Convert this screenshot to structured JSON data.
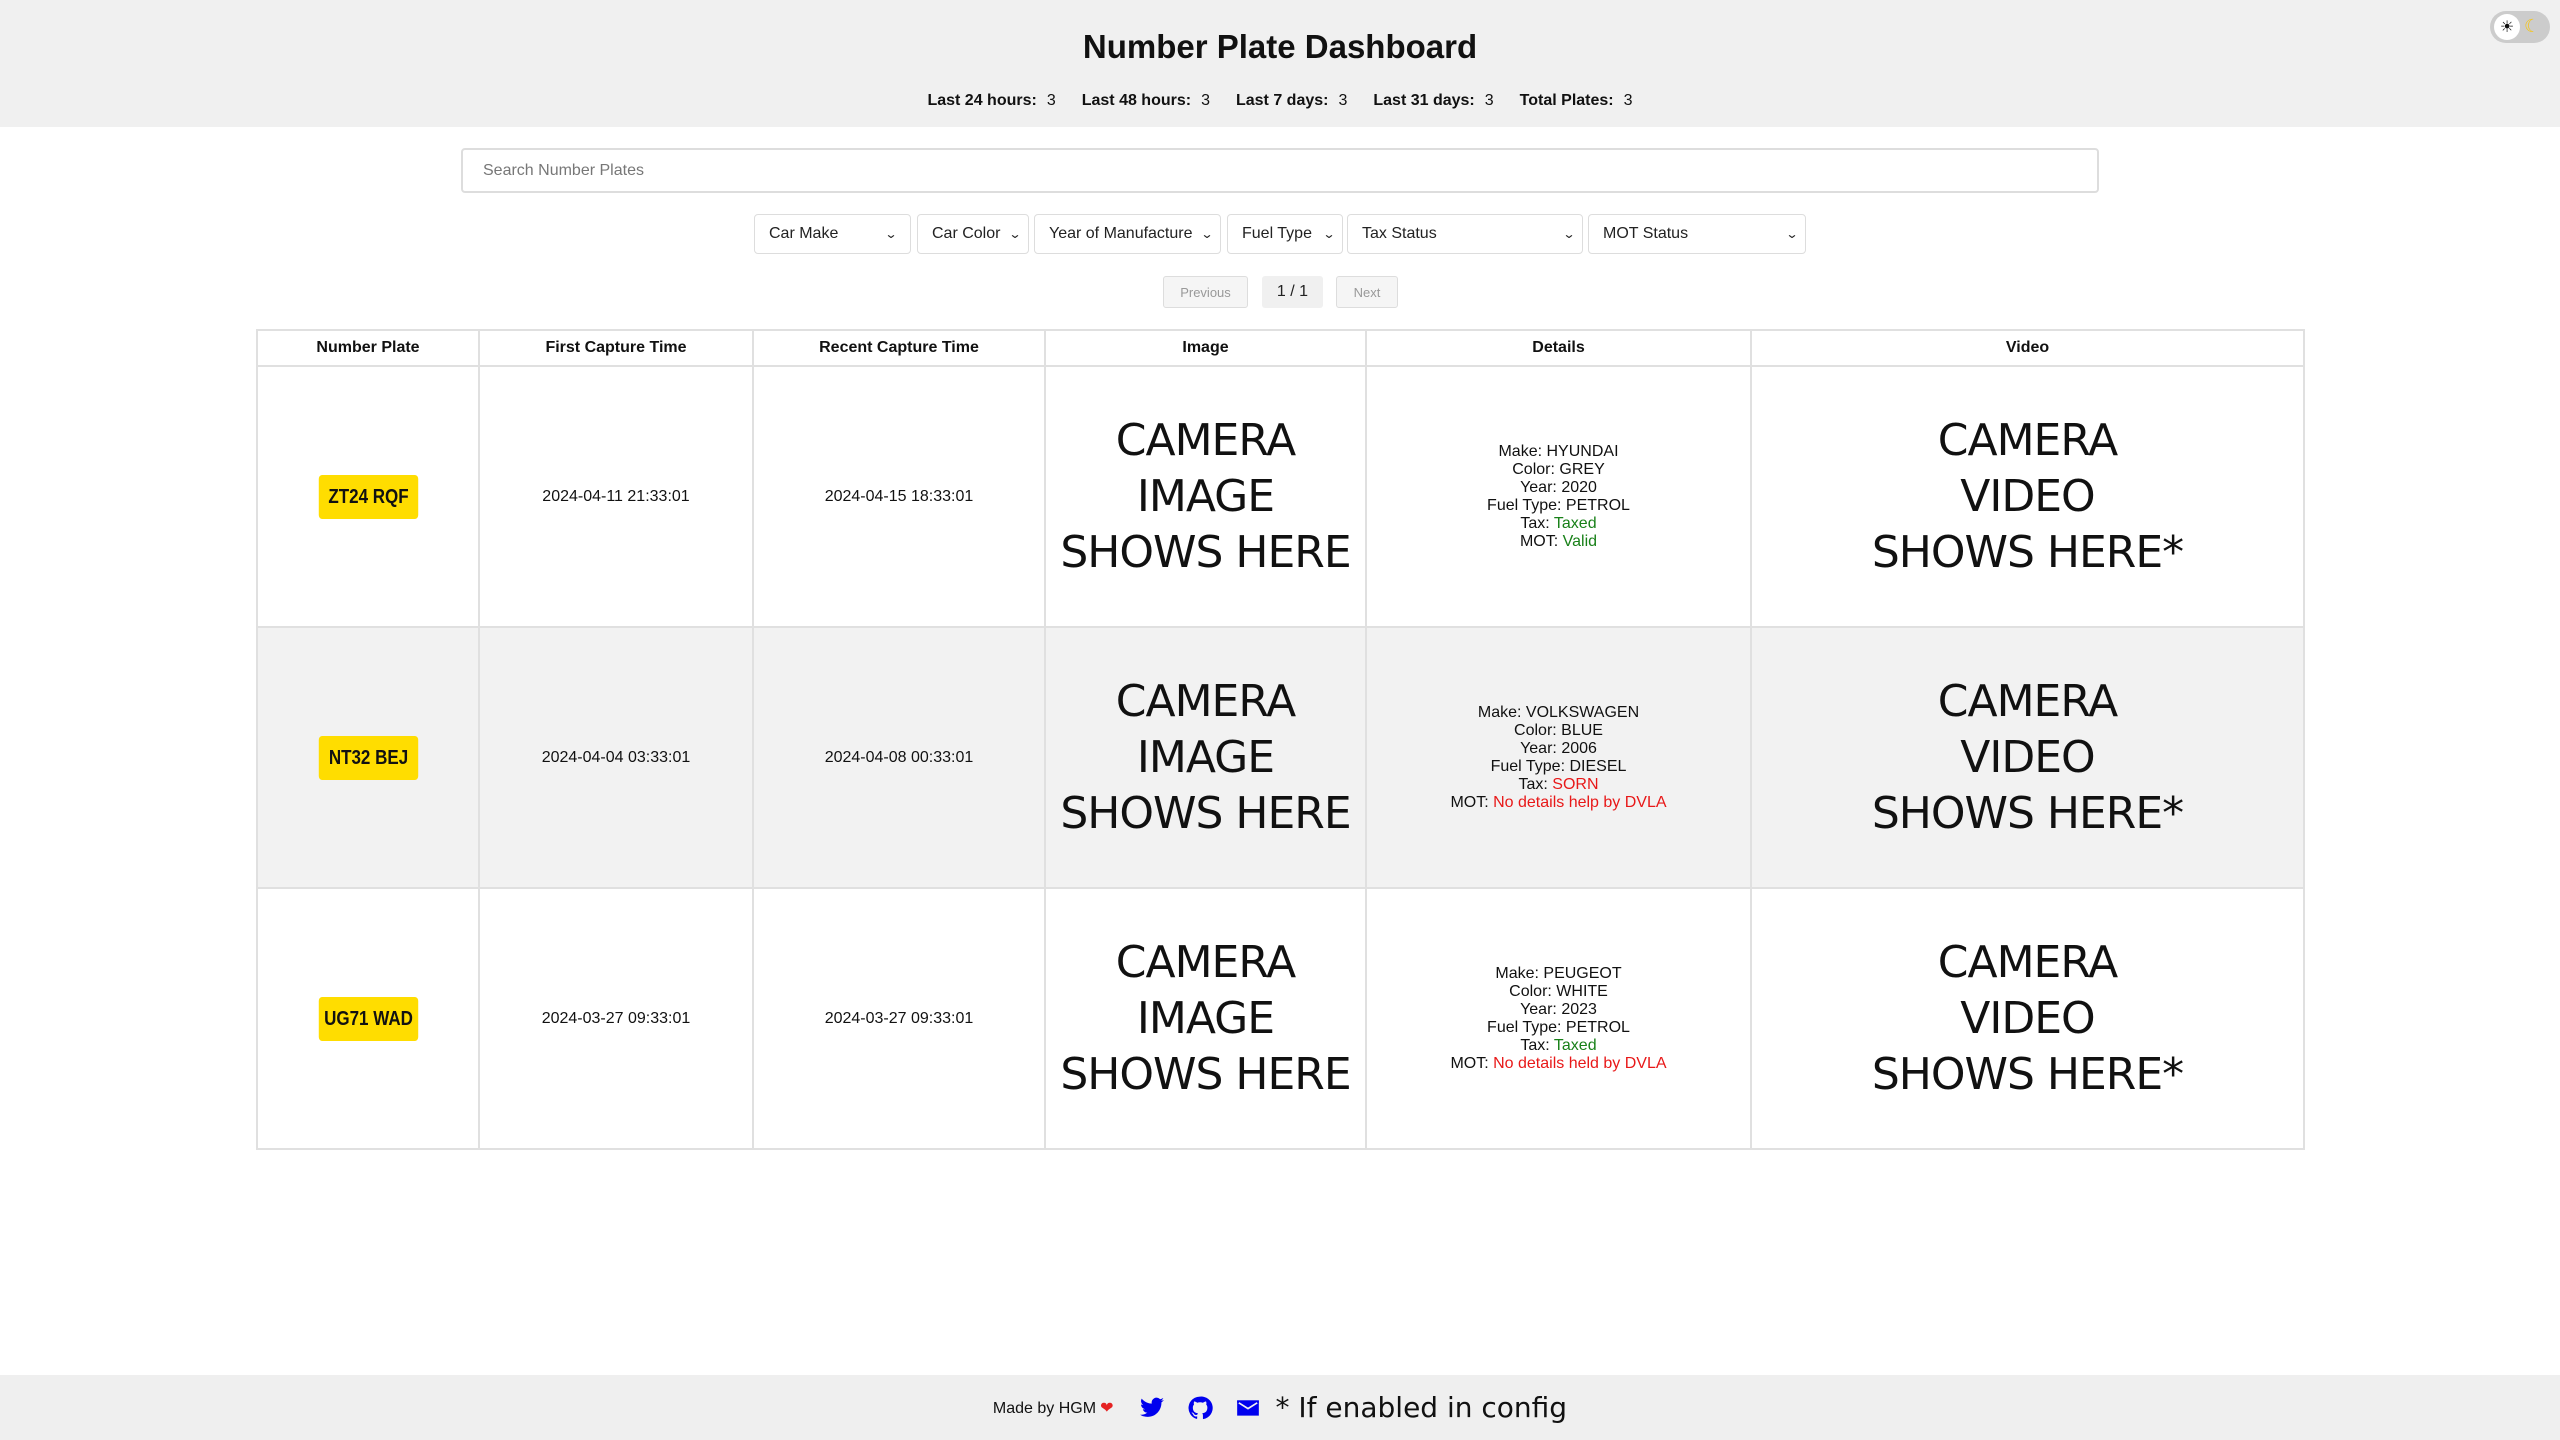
{
  "header": {
    "title": "Number Plate Dashboard",
    "stats": [
      {
        "label": "Last 24 hours:",
        "value": "3"
      },
      {
        "label": "Last 48 hours:",
        "value": "3"
      },
      {
        "label": "Last 7 days:",
        "value": "3"
      },
      {
        "label": "Last 31 days:",
        "value": "3"
      },
      {
        "label": "Total Plates:",
        "value": "3"
      }
    ],
    "theme_toggle": {
      "sun_icon": "☀",
      "moon_icon": "🌙",
      "state": "light"
    }
  },
  "search": {
    "placeholder": "Search Number Plates",
    "value": ""
  },
  "filters": [
    {
      "name": "car-make",
      "selected": "Car Make"
    },
    {
      "name": "car-color",
      "selected": "Car Color"
    },
    {
      "name": "year-of-manufacture",
      "selected": "Year of Manufacture"
    },
    {
      "name": "fuel-type",
      "selected": "Fuel Type"
    },
    {
      "name": "tax-status",
      "selected": "Tax Status"
    },
    {
      "name": "mot-status",
      "selected": "MOT Status"
    }
  ],
  "pagination": {
    "previous_label": "Previous",
    "page_info": "1 / 1",
    "next_label": "Next"
  },
  "table": {
    "columns": [
      "Number Plate",
      "First Capture Time",
      "Recent Capture Time",
      "Image",
      "Details",
      "Video"
    ],
    "rows": [
      {
        "plate": "ZT24 RQF",
        "first_capture": "2024-04-11 21:33:01",
        "recent_capture": "2024-04-15 18:33:01",
        "image": [
          "CAMERA",
          "IMAGE",
          "SHOWS HERE"
        ],
        "details": {
          "make_label": "Make:",
          "make": "HYUNDAI",
          "color_label": "Color:",
          "color": "GREY",
          "year_label": "Year:",
          "year": "2020",
          "fuel_label": "Fuel Type:",
          "fuel": "PETROL",
          "tax_label": "Tax:",
          "tax": "Taxed",
          "tax_status": "ok",
          "mot_label": "MOT:",
          "mot": "Valid",
          "mot_status": "ok"
        },
        "video": [
          "CAMERA",
          "VIDEO",
          "SHOWS HERE*"
        ]
      },
      {
        "plate": "NT32 BEJ",
        "first_capture": "2024-04-04 03:33:01",
        "recent_capture": "2024-04-08 00:33:01",
        "image": [
          "CAMERA",
          "IMAGE",
          "SHOWS HERE"
        ],
        "details": {
          "make_label": "Make:",
          "make": "VOLKSWAGEN",
          "color_label": "Color:",
          "color": "BLUE",
          "year_label": "Year:",
          "year": "2006",
          "fuel_label": "Fuel Type:",
          "fuel": "DIESEL",
          "tax_label": "Tax:",
          "tax": "SORN",
          "tax_status": "bad",
          "mot_label": "MOT:",
          "mot": "No details help by DVLA",
          "mot_status": "bad"
        },
        "video": [
          "CAMERA",
          "VIDEO",
          "SHOWS HERE*"
        ]
      },
      {
        "plate": "UG71 WAD",
        "first_capture": "2024-03-27 09:33:01",
        "recent_capture": "2024-03-27 09:33:01",
        "image": [
          "CAMERA",
          "IMAGE",
          "SHOWS HERE"
        ],
        "details": {
          "make_label": "Make:",
          "make": "PEUGEOT",
          "color_label": "Color:",
          "color": "WHITE",
          "year_label": "Year:",
          "year": "2023",
          "fuel_label": "Fuel Type:",
          "fuel": "PETROL",
          "tax_label": "Tax:",
          "tax": "Taxed",
          "tax_status": "ok",
          "mot_label": "MOT:",
          "mot": "No details held by DVLA",
          "mot_status": "bad"
        },
        "video": [
          "CAMERA",
          "VIDEO",
          "SHOWS HERE*"
        ]
      }
    ]
  },
  "footer": {
    "made_by": "Made by HGM",
    "heart_icon": "❤",
    "icons": [
      "twitter-icon",
      "github-icon",
      "email-icon"
    ],
    "config_note": "* If enabled in config"
  },
  "colors": {
    "plate_yellow": "#ffdd00",
    "status_ok": "#188018",
    "status_bad": "#e81818",
    "footer_icon": "#0000ee",
    "header_bg": "#f0f0f0"
  }
}
